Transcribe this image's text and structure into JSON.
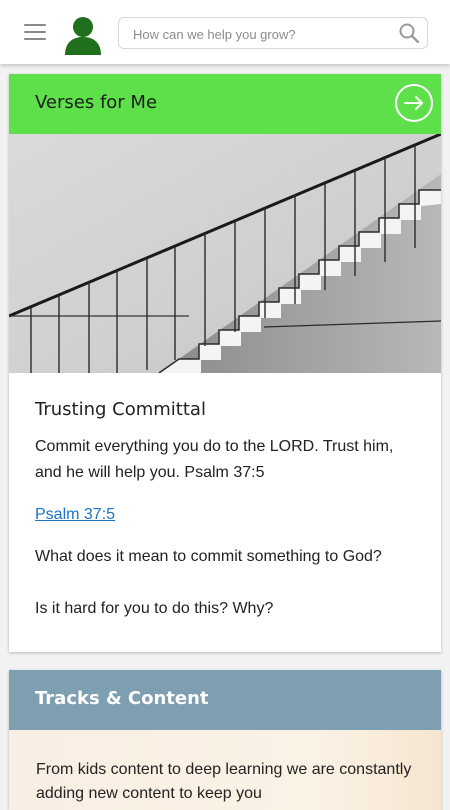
{
  "header": {
    "search_placeholder": "How can we help you grow?",
    "icons": {
      "menu": "hamburger-menu-icon",
      "avatar": "user-avatar-icon",
      "search": "magnifier-icon"
    }
  },
  "verses_card": {
    "title": "Verses for Me",
    "header_color": "#5ee04a",
    "arrow_icon": "arrow-right-circle-icon",
    "heading": "Trusting Committal",
    "verse_text": "Commit everything you do to the LORD. Trust him, and he will help you. Psalm 37:5",
    "reference_link": "Psalm 37:5",
    "question_1": "What does it mean to commit something to God?",
    "question_2": "Is it hard for you to do this? Why?"
  },
  "tracks_card": {
    "title": "Tracks & Content",
    "header_color": "#7d9fb1",
    "description": "From kids content to deep learning we are constantly adding new content to keep you"
  }
}
